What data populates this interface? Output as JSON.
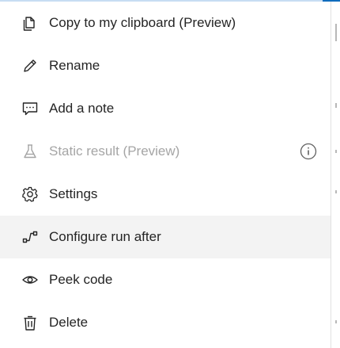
{
  "menu": {
    "items": [
      {
        "label": "Copy to my clipboard (Preview)",
        "icon": "copy-icon"
      },
      {
        "label": "Rename",
        "icon": "pencil-icon"
      },
      {
        "label": "Add a note",
        "icon": "note-icon"
      },
      {
        "label": "Static result (Preview)",
        "icon": "flask-icon",
        "disabled": true,
        "trailing_icon": "info-icon"
      },
      {
        "label": "Settings",
        "icon": "gear-icon"
      },
      {
        "label": "Configure run after",
        "icon": "run-after-icon",
        "highlighted": true
      },
      {
        "label": "Peek code",
        "icon": "eye-icon"
      },
      {
        "label": "Delete",
        "icon": "trash-icon"
      }
    ]
  },
  "colors": {
    "text": "#242424",
    "disabled_text": "#a5a5a5",
    "hover_background": "#f3f3f3",
    "accent": "#0f6cbd"
  }
}
